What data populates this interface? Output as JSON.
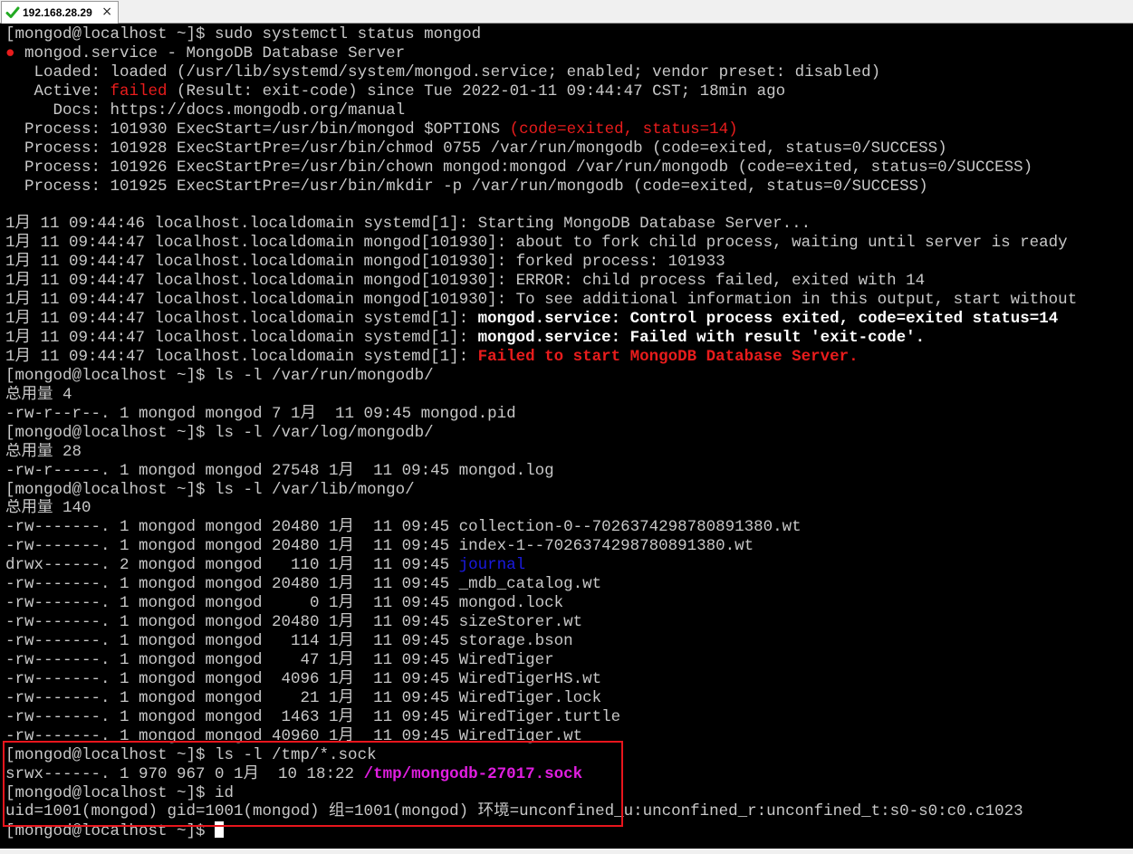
{
  "tab": {
    "title": "192.168.28.29",
    "close_glyph": "×",
    "icon": "check-icon",
    "icon_color": "#22aa22"
  },
  "colors": {
    "background": "#000000",
    "foreground": "#c8c8c8",
    "red": "#e81c1c",
    "blue": "#1a1ae0",
    "magenta": "#e01ee0",
    "highlight_box": "#e8151c"
  },
  "terminal": {
    "lines": [
      [
        {
          "t": "[mongod@localhost ~]$ sudo systemctl status mongod"
        }
      ],
      [
        {
          "t": "●",
          "c": "red"
        },
        {
          "t": " mongod.service - MongoDB Database Server"
        }
      ],
      [
        {
          "t": "   Loaded: loaded (/usr/lib/systemd/system/mongod.service; enabled; vendor preset: disabled)"
        }
      ],
      [
        {
          "t": "   Active: "
        },
        {
          "t": "failed",
          "c": "red"
        },
        {
          "t": " (Result: exit-code) since Tue 2022-01-11 09:44:47 CST; 18min ago"
        }
      ],
      [
        {
          "t": "     Docs: https://docs.mongodb.org/manual"
        }
      ],
      [
        {
          "t": "  Process: 101930 ExecStart=/usr/bin/mongod $OPTIONS "
        },
        {
          "t": "(code=exited, status=14)",
          "c": "red"
        }
      ],
      [
        {
          "t": "  Process: 101928 ExecStartPre=/usr/bin/chmod 0755 /var/run/mongodb (code=exited, status=0/SUCCESS)"
        }
      ],
      [
        {
          "t": "  Process: 101926 ExecStartPre=/usr/bin/chown mongod:mongod /var/run/mongodb (code=exited, status=0/SUCCESS)"
        }
      ],
      [
        {
          "t": "  Process: 101925 ExecStartPre=/usr/bin/mkdir -p /var/run/mongodb (code=exited, status=0/SUCCESS)"
        }
      ],
      [
        {
          "t": ""
        }
      ],
      [
        {
          "t": "1月 11 09:44:46 localhost.localdomain systemd[1]: Starting MongoDB Database Server..."
        }
      ],
      [
        {
          "t": "1月 11 09:44:47 localhost.localdomain mongod[101930]: about to fork child process, waiting until server is ready"
        }
      ],
      [
        {
          "t": "1月 11 09:44:47 localhost.localdomain mongod[101930]: forked process: 101933"
        }
      ],
      [
        {
          "t": "1月 11 09:44:47 localhost.localdomain mongod[101930]: ERROR: child process failed, exited with 14"
        }
      ],
      [
        {
          "t": "1月 11 09:44:47 localhost.localdomain mongod[101930]: To see additional information in this output, start without"
        }
      ],
      [
        {
          "t": "1月 11 09:44:47 localhost.localdomain systemd[1]: "
        },
        {
          "t": "mongod.service: Control process exited, code=exited status=14",
          "c": "white",
          "b": true
        }
      ],
      [
        {
          "t": "1月 11 09:44:47 localhost.localdomain systemd[1]: "
        },
        {
          "t": "mongod.service: Failed with result 'exit-code'.",
          "c": "white",
          "b": true
        }
      ],
      [
        {
          "t": "1月 11 09:44:47 localhost.localdomain systemd[1]: "
        },
        {
          "t": "Failed to start MongoDB Database Server.",
          "c": "red",
          "b": true
        }
      ],
      [
        {
          "t": "[mongod@localhost ~]$ ls -l /var/run/mongodb/"
        }
      ],
      [
        {
          "t": "总用量 4"
        }
      ],
      [
        {
          "t": "-rw-r--r--. 1 mongod mongod 7 1月  11 09:45 mongod.pid"
        }
      ],
      [
        {
          "t": "[mongod@localhost ~]$ ls -l /var/log/mongodb/"
        }
      ],
      [
        {
          "t": "总用量 28"
        }
      ],
      [
        {
          "t": "-rw-r-----. 1 mongod mongod 27548 1月  11 09:45 mongod.log"
        }
      ],
      [
        {
          "t": "[mongod@localhost ~]$ ls -l /var/lib/mongo/"
        }
      ],
      [
        {
          "t": "总用量 140"
        }
      ],
      [
        {
          "t": "-rw-------. 1 mongod mongod 20480 1月  11 09:45 collection-0--7026374298780891380.wt"
        }
      ],
      [
        {
          "t": "-rw-------. 1 mongod mongod 20480 1月  11 09:45 index-1--7026374298780891380.wt"
        }
      ],
      [
        {
          "t": "drwx------. 2 mongod mongod   110 1月  11 09:45 "
        },
        {
          "t": "journal",
          "c": "blue"
        }
      ],
      [
        {
          "t": "-rw-------. 1 mongod mongod 20480 1月  11 09:45 _mdb_catalog.wt"
        }
      ],
      [
        {
          "t": "-rw-------. 1 mongod mongod     0 1月  11 09:45 mongod.lock"
        }
      ],
      [
        {
          "t": "-rw-------. 1 mongod mongod 20480 1月  11 09:45 sizeStorer.wt"
        }
      ],
      [
        {
          "t": "-rw-------. 1 mongod mongod   114 1月  11 09:45 storage.bson"
        }
      ],
      [
        {
          "t": "-rw-------. 1 mongod mongod    47 1月  11 09:45 WiredTiger"
        }
      ],
      [
        {
          "t": "-rw-------. 1 mongod mongod  4096 1月  11 09:45 WiredTigerHS.wt"
        }
      ],
      [
        {
          "t": "-rw-------. 1 mongod mongod    21 1月  11 09:45 WiredTiger.lock"
        }
      ],
      [
        {
          "t": "-rw-------. 1 mongod mongod  1463 1月  11 09:45 WiredTiger.turtle"
        }
      ],
      [
        {
          "t": "-rw-------. 1 mongod mongod 40960 1月  11 09:45 WiredTiger.wt"
        }
      ],
      [
        {
          "t": "[mongod@localhost ~]$ ls -l /tmp/*.sock"
        }
      ],
      [
        {
          "t": "srwx------. 1 970 967 0 1月  10 18:22 "
        },
        {
          "t": "/tmp/mongodb-27017.sock",
          "c": "magenta",
          "b": true
        }
      ],
      [
        {
          "t": "[mongod@localhost ~]$ id"
        }
      ],
      [
        {
          "t": "uid=1001(mongod) gid=1001(mongod) 组=1001(mongod) 环境=unconfined_u:unconfined_r:unconfined_t:s0-s0:c0.c1023"
        }
      ],
      [
        {
          "t": "[mongod@localhost ~]$ "
        },
        {
          "cursor": true
        }
      ]
    ]
  }
}
